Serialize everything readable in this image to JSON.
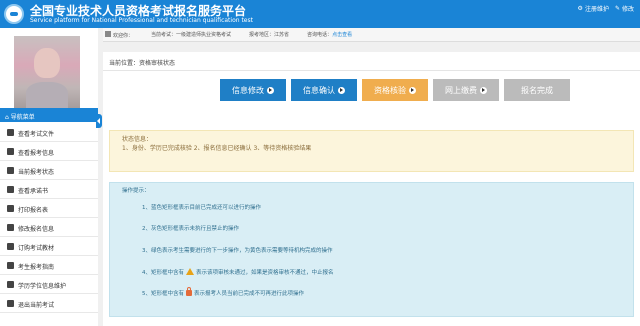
{
  "header": {
    "title": "全国专业技术人员资格考试报名服务平台",
    "subtitle": "Service platform for National Professional and technician qualification test",
    "links": [
      {
        "icon": "gear-icon",
        "label": "注册维护"
      },
      {
        "icon": "edit-icon",
        "label": "修改"
      }
    ]
  },
  "infobar": {
    "welcome": "欢迎你：",
    "exam": "当前考试：一级建造师执业资格考试",
    "region": "报考地区：江苏省",
    "phone_label": "咨询电话：",
    "phone_link": "点击查看"
  },
  "sidebar": {
    "nav_title": "导航菜单",
    "items": [
      {
        "label": "查看考试文件",
        "icon": "document-icon"
      },
      {
        "label": "查看报考信息",
        "icon": "info-icon"
      },
      {
        "label": "当前报考状态",
        "icon": "monitor-icon"
      },
      {
        "label": "查看承诺书",
        "icon": "book-icon"
      },
      {
        "label": "打印报名表",
        "icon": "print-icon"
      },
      {
        "label": "修改报名信息",
        "icon": "edit-icon"
      },
      {
        "label": "订购考试教材",
        "icon": "cart-icon"
      },
      {
        "label": "考生报考指南",
        "icon": "user-icon"
      },
      {
        "label": "学历学位信息维护",
        "icon": "graduation-icon"
      },
      {
        "label": "退出当前考试",
        "icon": "exit-icon"
      }
    ]
  },
  "main": {
    "location": "当前位置：资格审核状态",
    "steps": [
      {
        "label": "信息修改",
        "color": "#1f7fc6"
      },
      {
        "label": "信息确认",
        "color": "#1f7fc6"
      },
      {
        "label": "资格核验",
        "color": "#f0ad4e"
      },
      {
        "label": "网上缴费",
        "color": "#bbbbbb"
      },
      {
        "label": "报名完成",
        "color": "#bbbbbb"
      }
    ],
    "status_title": "状态信息：",
    "status_text": "1、身份、学历已完成核验 2、报名信息已经确认 3、等待资格核验结果",
    "tips_title": "操作提示：",
    "tips": [
      "1、蓝色矩形框表示目前已完成还可以进行的操作",
      "2、灰色矩形框表示未执行且禁止的操作",
      "3、绿色表示考生需要进行的下一步操作，为黄色表示需要等待机构完成的操作",
      "4、矩形框中含有",
      "5、矩形框中含有"
    ],
    "tip4_suffix": "表示该项审核未通过，如果是资格审核不通过，中止报名",
    "tip5_suffix": "表示报考人员当前已完成不可再进行此项操作"
  }
}
